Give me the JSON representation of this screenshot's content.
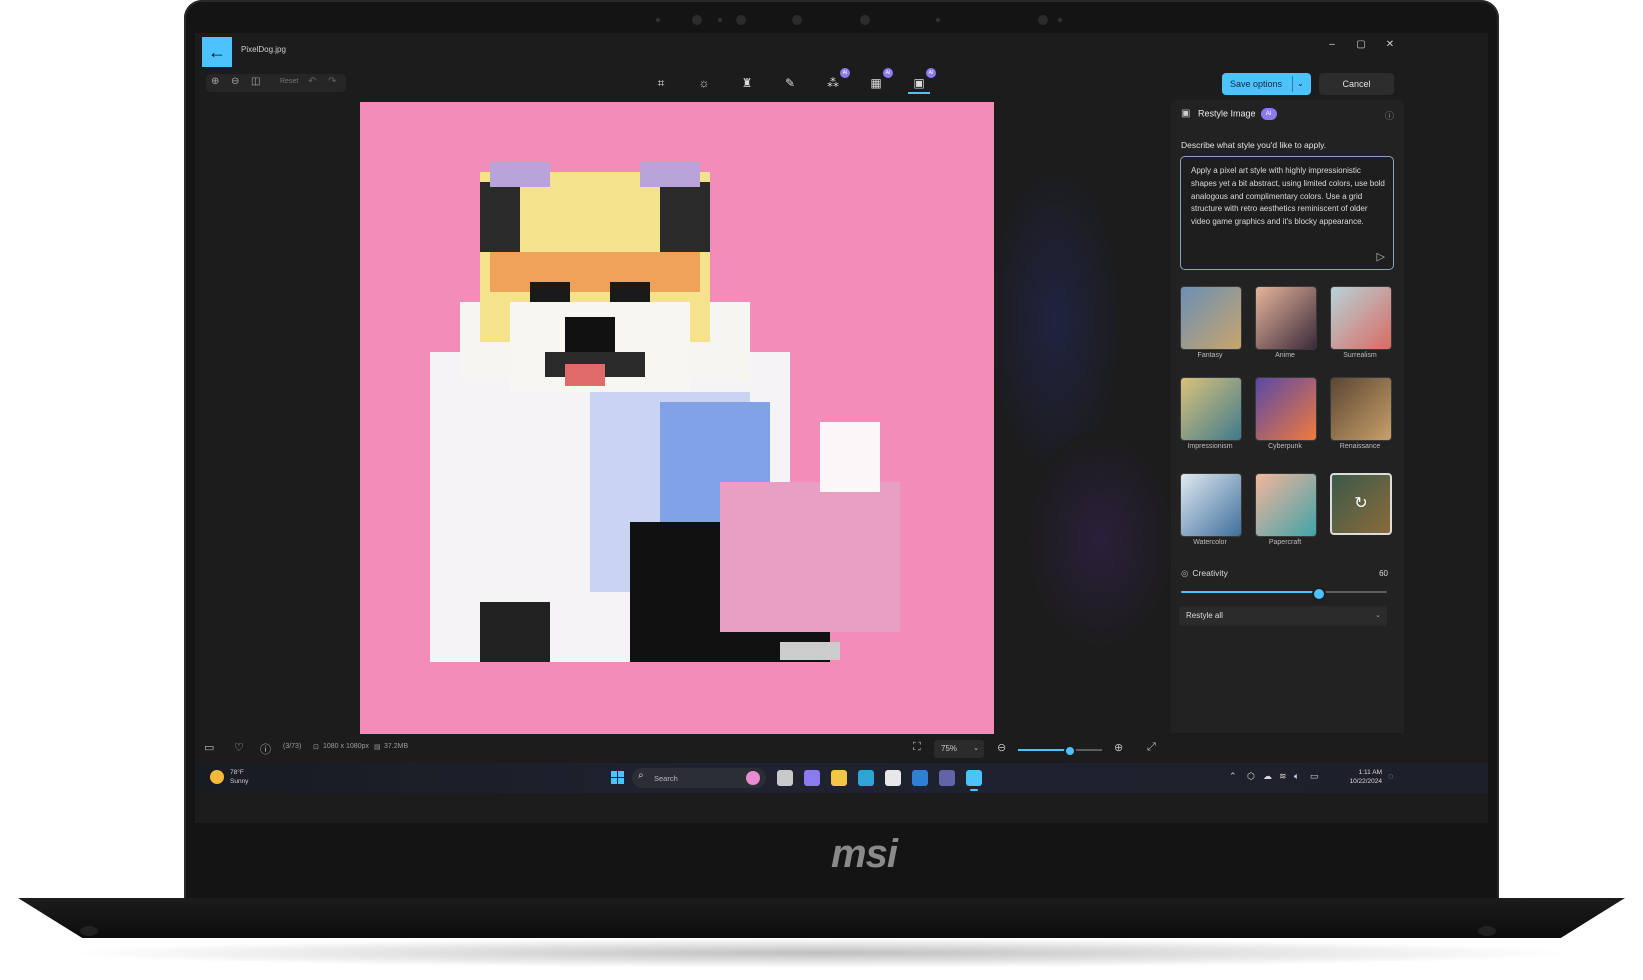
{
  "device": {
    "brand_logo": "msi"
  },
  "window": {
    "filename": "PixelDog.jpg",
    "controls": {
      "minimize": "–",
      "maximize": "▢",
      "close": "✕"
    }
  },
  "toolbar": {
    "reset_label": "Reset",
    "save_label": "Save options",
    "cancel_label": "Cancel",
    "tools": [
      {
        "name": "crop-icon",
        "glyph": "⌗",
        "ai": false
      },
      {
        "name": "adjust-icon",
        "glyph": "☼",
        "ai": false
      },
      {
        "name": "filter-icon",
        "glyph": "♜",
        "ai": false
      },
      {
        "name": "markup-icon",
        "glyph": "✎",
        "ai": false
      },
      {
        "name": "erase-icon",
        "glyph": "⁂",
        "ai": true
      },
      {
        "name": "background-icon",
        "glyph": "▦",
        "ai": true
      },
      {
        "name": "restyle-icon",
        "glyph": "▣",
        "ai": true
      }
    ],
    "ai_badge": "AI"
  },
  "panel": {
    "title": "Restyle Image",
    "ai_badge": "AI",
    "prompt_label": "Describe what style you'd like to apply.",
    "prompt_text": "Apply a pixel art style with highly impressionistic shapes yet a bit abstract, using limited colors, use bold analogous and complimentary colors. Use a grid structure with retro aesthetics reminiscent of older video game graphics and it's blocky appearance.",
    "styles": [
      {
        "name": "Fantasy",
        "c1": "#6b8fb5",
        "c2": "#c9a56b",
        "selected": false
      },
      {
        "name": "Anime",
        "c1": "#e6b49a",
        "c2": "#3b2a3a",
        "selected": false
      },
      {
        "name": "Surrealism",
        "c1": "#b7d3d8",
        "c2": "#d96b63",
        "selected": false
      },
      {
        "name": "Impressionism",
        "c1": "#d8c27a",
        "c2": "#3f7a8c",
        "selected": false
      },
      {
        "name": "Cyberpunk",
        "c1": "#5a48a8",
        "c2": "#f07a3c",
        "selected": false
      },
      {
        "name": "Renaissance",
        "c1": "#5a4632",
        "c2": "#c8a06a",
        "selected": false
      },
      {
        "name": "Watercolor",
        "c1": "#dfe9f0",
        "c2": "#3f6f9c",
        "selected": false
      },
      {
        "name": "Papercraft",
        "c1": "#f4b59c",
        "c2": "#3fa4a8",
        "selected": false
      },
      {
        "name": "",
        "c1": "#3b5a4a",
        "c2": "#8a6a3a",
        "selected": true
      }
    ],
    "creativity_label": "Creativity",
    "creativity_value": "60",
    "creativity_fraction": 0.67,
    "restyle_select": "Restyle all"
  },
  "statusbar": {
    "index": "(3/73)",
    "dimensions": "1080 x 1080px",
    "size": "37.2MB",
    "zoom": "75%",
    "zoom_fraction": 0.62
  },
  "taskbar": {
    "weather_temp": "78°F",
    "weather_cond": "Sunny",
    "search_label": "Search",
    "apps": [
      {
        "name": "task-view-app",
        "color": "#c9c9c9"
      },
      {
        "name": "copilot-app",
        "color": "#8c7bf0"
      },
      {
        "name": "file-explorer-app",
        "color": "#f2c744"
      },
      {
        "name": "edge-app",
        "color": "#2fa4d8"
      },
      {
        "name": "store-app",
        "color": "#e8e8e8"
      },
      {
        "name": "power-automate-app",
        "color": "#2f7fd8"
      },
      {
        "name": "teams-app",
        "color": "#6264a7"
      },
      {
        "name": "photos-app",
        "color": "#4cc2ff"
      }
    ],
    "time": "1:11 AM",
    "date": "10/22/2024"
  },
  "colors": {
    "accent": "#4cc2ff",
    "ai_purple": "#8c7bf0",
    "canvas_pink": "#f28cb9"
  }
}
